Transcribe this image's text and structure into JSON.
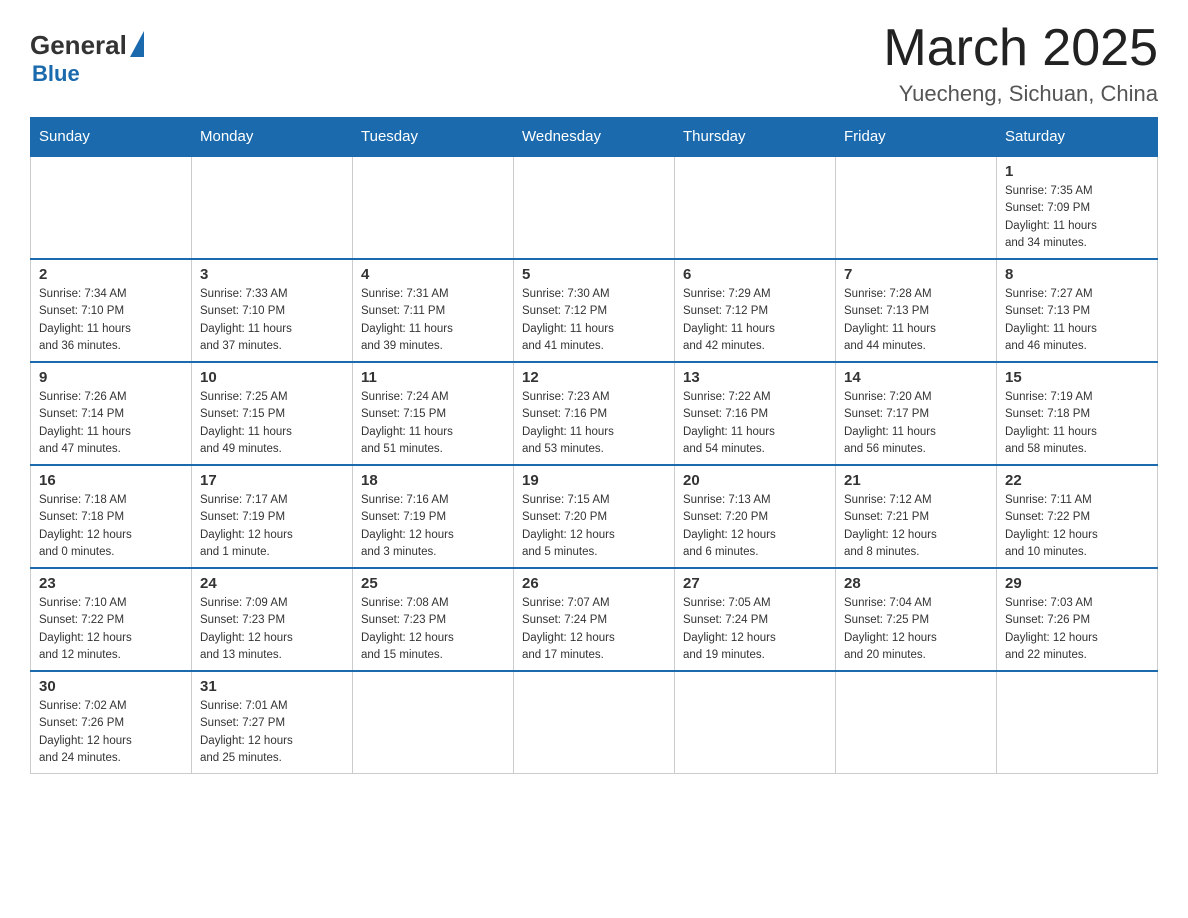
{
  "header": {
    "logo": {
      "general": "General",
      "blue": "Blue"
    },
    "title": "March 2025",
    "subtitle": "Yuecheng, Sichuan, China"
  },
  "weekdays": [
    "Sunday",
    "Monday",
    "Tuesday",
    "Wednesday",
    "Thursday",
    "Friday",
    "Saturday"
  ],
  "weeks": [
    [
      {
        "day": "",
        "info": ""
      },
      {
        "day": "",
        "info": ""
      },
      {
        "day": "",
        "info": ""
      },
      {
        "day": "",
        "info": ""
      },
      {
        "day": "",
        "info": ""
      },
      {
        "day": "",
        "info": ""
      },
      {
        "day": "1",
        "info": "Sunrise: 7:35 AM\nSunset: 7:09 PM\nDaylight: 11 hours\nand 34 minutes."
      }
    ],
    [
      {
        "day": "2",
        "info": "Sunrise: 7:34 AM\nSunset: 7:10 PM\nDaylight: 11 hours\nand 36 minutes."
      },
      {
        "day": "3",
        "info": "Sunrise: 7:33 AM\nSunset: 7:10 PM\nDaylight: 11 hours\nand 37 minutes."
      },
      {
        "day": "4",
        "info": "Sunrise: 7:31 AM\nSunset: 7:11 PM\nDaylight: 11 hours\nand 39 minutes."
      },
      {
        "day": "5",
        "info": "Sunrise: 7:30 AM\nSunset: 7:12 PM\nDaylight: 11 hours\nand 41 minutes."
      },
      {
        "day": "6",
        "info": "Sunrise: 7:29 AM\nSunset: 7:12 PM\nDaylight: 11 hours\nand 42 minutes."
      },
      {
        "day": "7",
        "info": "Sunrise: 7:28 AM\nSunset: 7:13 PM\nDaylight: 11 hours\nand 44 minutes."
      },
      {
        "day": "8",
        "info": "Sunrise: 7:27 AM\nSunset: 7:13 PM\nDaylight: 11 hours\nand 46 minutes."
      }
    ],
    [
      {
        "day": "9",
        "info": "Sunrise: 7:26 AM\nSunset: 7:14 PM\nDaylight: 11 hours\nand 47 minutes."
      },
      {
        "day": "10",
        "info": "Sunrise: 7:25 AM\nSunset: 7:15 PM\nDaylight: 11 hours\nand 49 minutes."
      },
      {
        "day": "11",
        "info": "Sunrise: 7:24 AM\nSunset: 7:15 PM\nDaylight: 11 hours\nand 51 minutes."
      },
      {
        "day": "12",
        "info": "Sunrise: 7:23 AM\nSunset: 7:16 PM\nDaylight: 11 hours\nand 53 minutes."
      },
      {
        "day": "13",
        "info": "Sunrise: 7:22 AM\nSunset: 7:16 PM\nDaylight: 11 hours\nand 54 minutes."
      },
      {
        "day": "14",
        "info": "Sunrise: 7:20 AM\nSunset: 7:17 PM\nDaylight: 11 hours\nand 56 minutes."
      },
      {
        "day": "15",
        "info": "Sunrise: 7:19 AM\nSunset: 7:18 PM\nDaylight: 11 hours\nand 58 minutes."
      }
    ],
    [
      {
        "day": "16",
        "info": "Sunrise: 7:18 AM\nSunset: 7:18 PM\nDaylight: 12 hours\nand 0 minutes."
      },
      {
        "day": "17",
        "info": "Sunrise: 7:17 AM\nSunset: 7:19 PM\nDaylight: 12 hours\nand 1 minute."
      },
      {
        "day": "18",
        "info": "Sunrise: 7:16 AM\nSunset: 7:19 PM\nDaylight: 12 hours\nand 3 minutes."
      },
      {
        "day": "19",
        "info": "Sunrise: 7:15 AM\nSunset: 7:20 PM\nDaylight: 12 hours\nand 5 minutes."
      },
      {
        "day": "20",
        "info": "Sunrise: 7:13 AM\nSunset: 7:20 PM\nDaylight: 12 hours\nand 6 minutes."
      },
      {
        "day": "21",
        "info": "Sunrise: 7:12 AM\nSunset: 7:21 PM\nDaylight: 12 hours\nand 8 minutes."
      },
      {
        "day": "22",
        "info": "Sunrise: 7:11 AM\nSunset: 7:22 PM\nDaylight: 12 hours\nand 10 minutes."
      }
    ],
    [
      {
        "day": "23",
        "info": "Sunrise: 7:10 AM\nSunset: 7:22 PM\nDaylight: 12 hours\nand 12 minutes."
      },
      {
        "day": "24",
        "info": "Sunrise: 7:09 AM\nSunset: 7:23 PM\nDaylight: 12 hours\nand 13 minutes."
      },
      {
        "day": "25",
        "info": "Sunrise: 7:08 AM\nSunset: 7:23 PM\nDaylight: 12 hours\nand 15 minutes."
      },
      {
        "day": "26",
        "info": "Sunrise: 7:07 AM\nSunset: 7:24 PM\nDaylight: 12 hours\nand 17 minutes."
      },
      {
        "day": "27",
        "info": "Sunrise: 7:05 AM\nSunset: 7:24 PM\nDaylight: 12 hours\nand 19 minutes."
      },
      {
        "day": "28",
        "info": "Sunrise: 7:04 AM\nSunset: 7:25 PM\nDaylight: 12 hours\nand 20 minutes."
      },
      {
        "day": "29",
        "info": "Sunrise: 7:03 AM\nSunset: 7:26 PM\nDaylight: 12 hours\nand 22 minutes."
      }
    ],
    [
      {
        "day": "30",
        "info": "Sunrise: 7:02 AM\nSunset: 7:26 PM\nDaylight: 12 hours\nand 24 minutes."
      },
      {
        "day": "31",
        "info": "Sunrise: 7:01 AM\nSunset: 7:27 PM\nDaylight: 12 hours\nand 25 minutes."
      },
      {
        "day": "",
        "info": ""
      },
      {
        "day": "",
        "info": ""
      },
      {
        "day": "",
        "info": ""
      },
      {
        "day": "",
        "info": ""
      },
      {
        "day": "",
        "info": ""
      }
    ]
  ]
}
